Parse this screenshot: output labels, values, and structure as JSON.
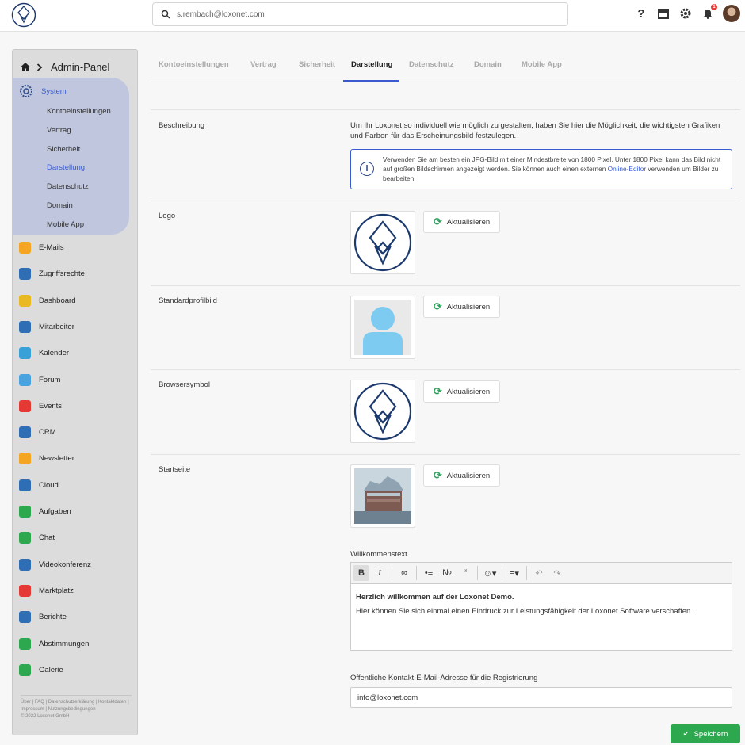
{
  "header": {
    "search_value": "s.rembach@loxonet.com",
    "notification_count": "1"
  },
  "sidebar": {
    "title": "Admin-Panel",
    "system_label": "System",
    "system_subitems": [
      "Kontoeinstellungen",
      "Vertrag",
      "Sicherheit",
      "Darstellung",
      "Datenschutz",
      "Domain",
      "Mobile App"
    ],
    "active_subitem": "Darstellung",
    "items": [
      {
        "label": "E-Mails",
        "icon": "email-icon",
        "color": "#f4a623"
      },
      {
        "label": "Zugriffsrechte",
        "icon": "shield-icon",
        "color": "#2f6db5"
      },
      {
        "label": "Dashboard",
        "icon": "dashboard-icon",
        "color": "#e8b923"
      },
      {
        "label": "Mitarbeiter",
        "icon": "people-icon",
        "color": "#2f6db5"
      },
      {
        "label": "Kalender",
        "icon": "calendar-icon",
        "color": "#3aa0d8"
      },
      {
        "label": "Forum",
        "icon": "forum-icon",
        "color": "#4aa3df"
      },
      {
        "label": "Events",
        "icon": "events-icon",
        "color": "#e53935"
      },
      {
        "label": "CRM",
        "icon": "crm-icon",
        "color": "#2f6db5"
      },
      {
        "label": "Newsletter",
        "icon": "newsletter-icon",
        "color": "#f4a623"
      },
      {
        "label": "Cloud",
        "icon": "cloud-icon",
        "color": "#2f6db5"
      },
      {
        "label": "Aufgaben",
        "icon": "tasks-icon",
        "color": "#2ea84f"
      },
      {
        "label": "Chat",
        "icon": "chat-icon",
        "color": "#2ea84f"
      },
      {
        "label": "Videokonferenz",
        "icon": "video-icon",
        "color": "#2f6db5"
      },
      {
        "label": "Marktplatz",
        "icon": "market-icon",
        "color": "#e53935"
      },
      {
        "label": "Berichte",
        "icon": "reports-icon",
        "color": "#2f6db5"
      },
      {
        "label": "Abstimmungen",
        "icon": "poll-icon",
        "color": "#2ea84f"
      },
      {
        "label": "Galerie",
        "icon": "gallery-icon",
        "color": "#2ea84f"
      }
    ],
    "footer": {
      "links": "Über | FAQ | Datenschutzerklärung | Kontaktdaten | Impressum | Nutzungsbedingungen",
      "copyright": "© 2022 Loxonet GmbH"
    }
  },
  "tabs": [
    "Kontoeinstellungen",
    "Vertrag",
    "Sicherheit",
    "Darstellung",
    "Datenschutz",
    "Domain",
    "Mobile App"
  ],
  "active_tab": "Darstellung",
  "content": {
    "beschreibung_label": "Beschreibung",
    "beschreibung_text": "Um Ihr Loxonet so individuell wie möglich zu gestalten, haben Sie hier die Möglichkeit, die wichtigsten Grafiken und Farben für das Erscheinungsbild festzulegen.",
    "info_text": "Verwenden Sie am besten ein JPG-Bild mit einer Mindestbreite von 1800 Pixel. Unter 1800 Pixel kann das Bild nicht auf großen Bildschirmen angezeigt werden. Sie können auch einen externen",
    "info_link": "Online-Editor",
    "info_text_end": "verwenden um Bilder zu bearbeiten.",
    "logo_label": "Logo",
    "profilbild_label": "Standardprofilbild",
    "browsersymbol_label": "Browsersymbol",
    "startseite_label": "Startseite",
    "update_label": "Aktualisieren",
    "willkommen_label": "Willkommenstext",
    "welcome_heading": "Herzlich willkommen auf der Loxonet Demo.",
    "welcome_body": "Hier können Sie sich einmal einen Eindruck zur Leistungsfähigkeit der Loxonet Software verschaffen.",
    "email_label": "Öffentliche Kontakt-E-Mail-Adresse für die Registrierung",
    "email_value": "info@loxonet.com",
    "save_label": "Speichern"
  },
  "colors": {
    "accent": "#3a5bd0",
    "logo_navy": "#1d3a6e",
    "save_green": "#2ea84f"
  }
}
